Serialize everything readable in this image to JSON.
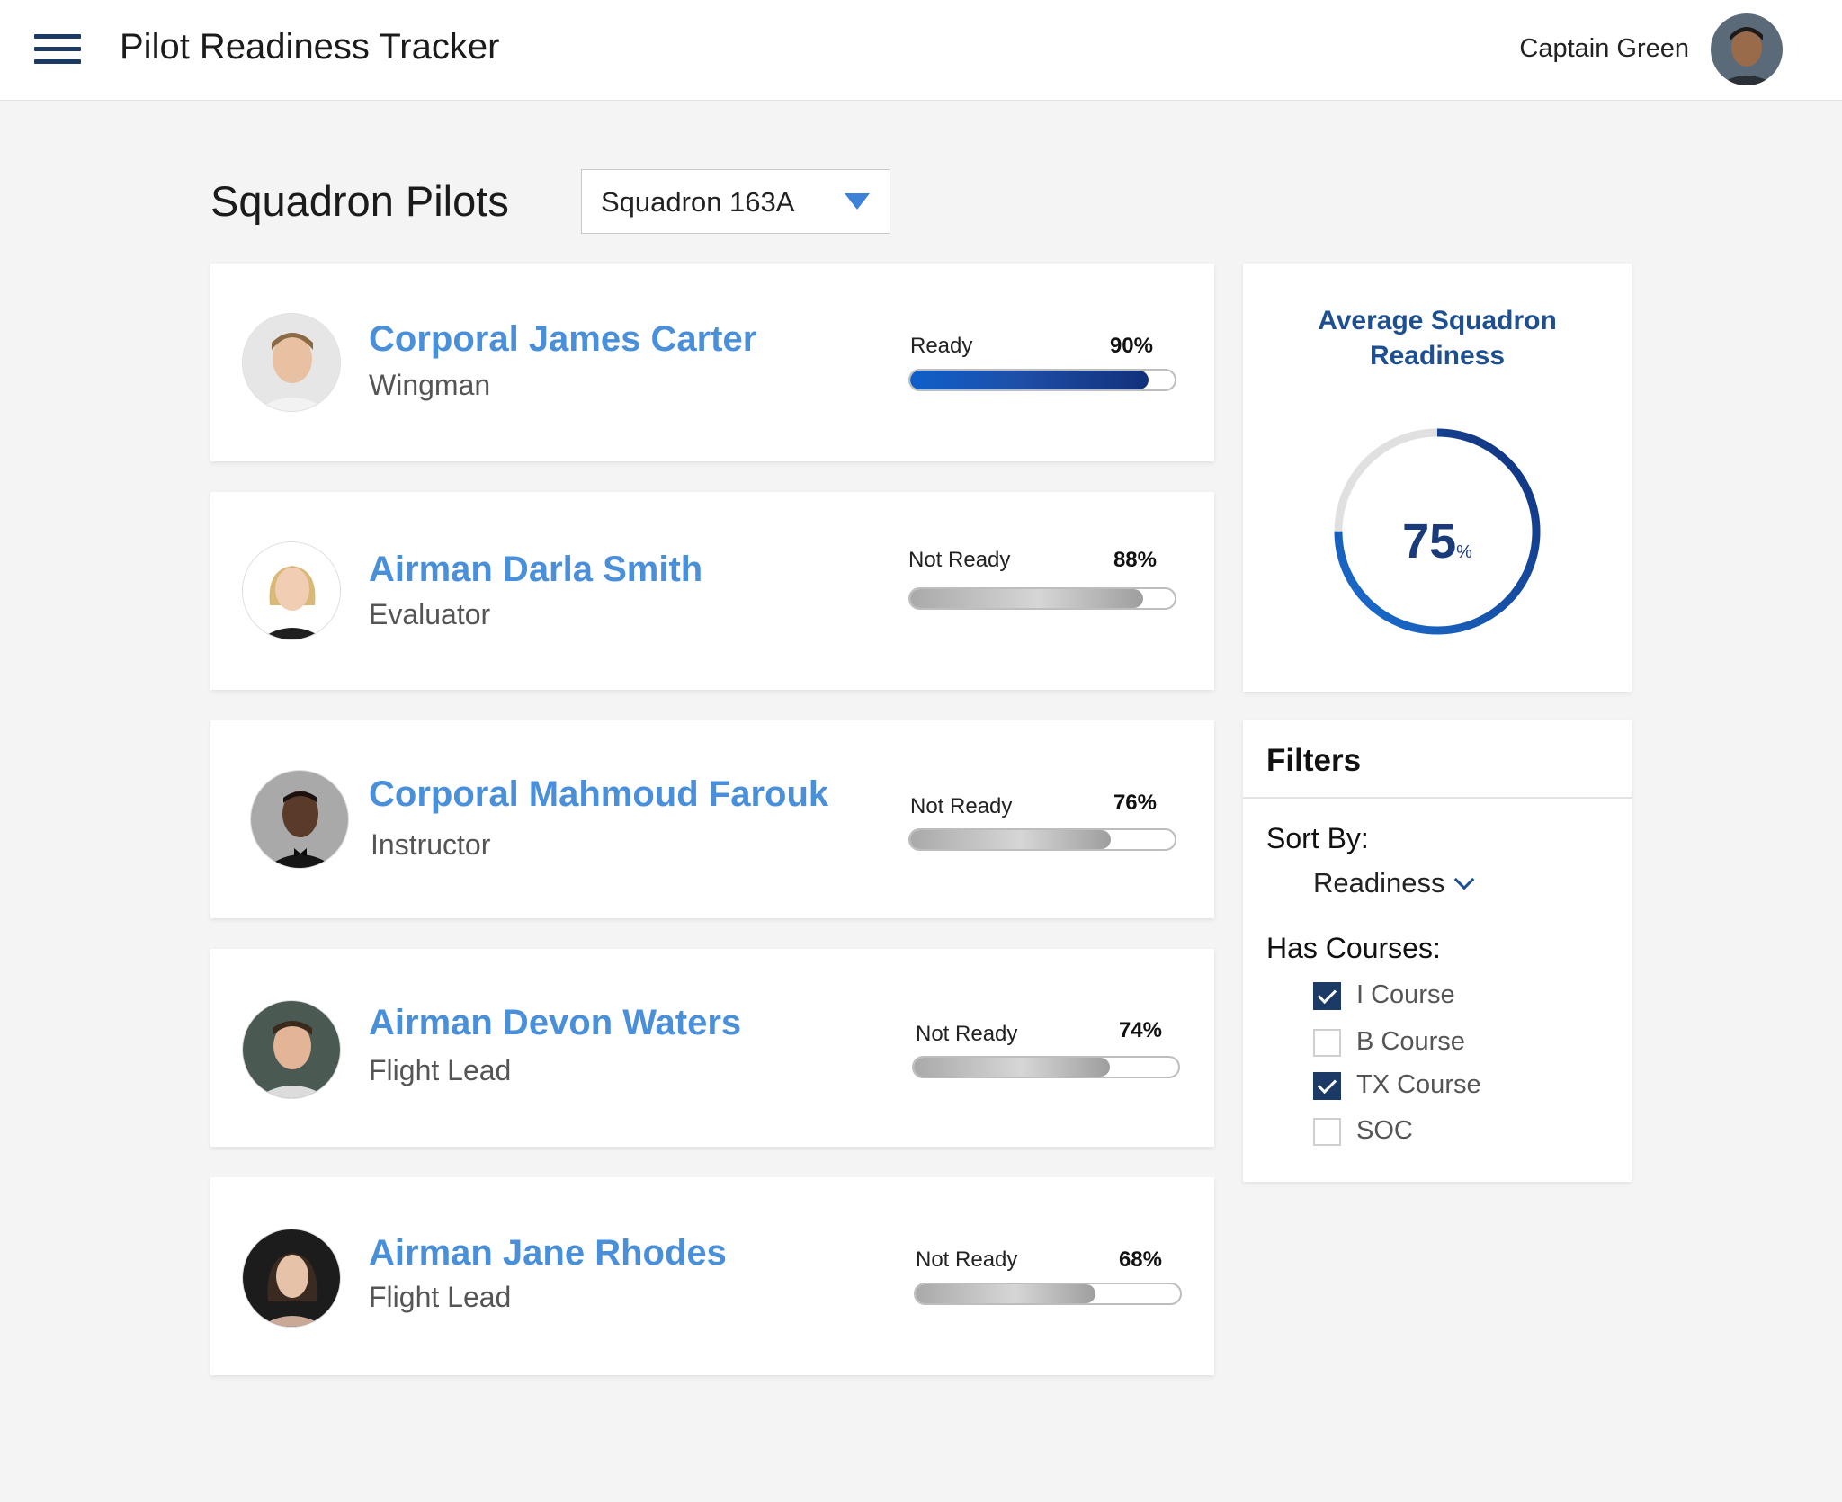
{
  "header": {
    "title": "Pilot Readiness Tracker",
    "user_name": "Captain Green",
    "menu_icon": "hamburger-menu-icon"
  },
  "main": {
    "section_title": "Squadron Pilots",
    "squadron_select": {
      "value": "Squadron 163A"
    }
  },
  "pilots": [
    {
      "name": "Corporal James Carter",
      "role": "Wingman",
      "status": "Ready",
      "readiness_label": "90%",
      "readiness": 90
    },
    {
      "name": "Airman Darla Smith",
      "role": "Evaluator",
      "status": "Not Ready",
      "readiness_label": "88%",
      "readiness": 88
    },
    {
      "name": "Corporal Mahmoud Farouk",
      "role": "Instructor",
      "status": "Not Ready",
      "readiness_label": "76%",
      "readiness": 76
    },
    {
      "name": "Airman Devon Waters",
      "role": "Flight Lead",
      "status": "Not Ready",
      "readiness_label": "74%",
      "readiness": 74
    },
    {
      "name": "Airman Jane Rhodes",
      "role": "Flight Lead",
      "status": "Not Ready",
      "readiness_label": "68%",
      "readiness": 68
    }
  ],
  "average_readiness": {
    "title_line1": "Average Squadron",
    "title_line2": "Readiness",
    "value": "75",
    "unit": "%",
    "fraction": 0.75
  },
  "filters": {
    "title": "Filters",
    "sort_by_label": "Sort By:",
    "sort_by_value": "Readiness",
    "has_courses_label": "Has Courses:",
    "courses": [
      {
        "label": "I Course",
        "checked": true
      },
      {
        "label": "B Course",
        "checked": false
      },
      {
        "label": "TX Course",
        "checked": true
      },
      {
        "label": "SOC",
        "checked": false
      }
    ]
  },
  "colors": {
    "accent_blue": "#4a8fd9",
    "navy": "#1b3a66",
    "ready_bar": "#1e4fa8",
    "not_ready_bar": "#b5b5b5"
  }
}
